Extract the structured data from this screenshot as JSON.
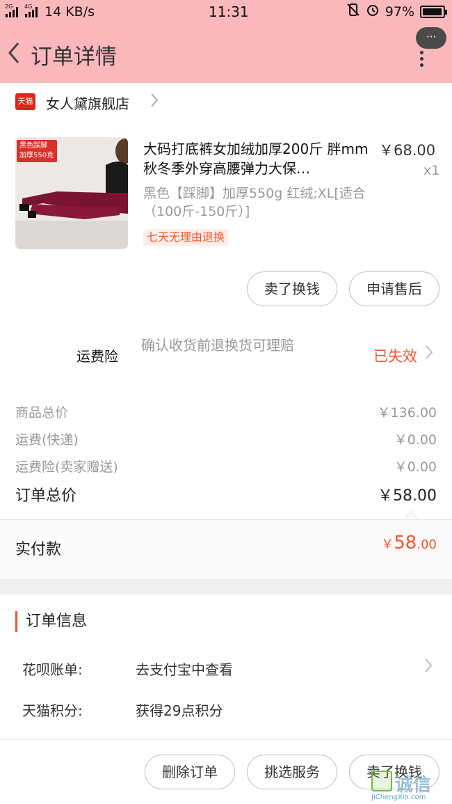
{
  "status_bar": {
    "network_left": "2G",
    "network_right": "4G",
    "speed": "14 KB/s",
    "time": "11:31",
    "battery": "97%",
    "battery_level": 0.97
  },
  "nav": {
    "title": "订单详情",
    "more_bubble": "···"
  },
  "shop": {
    "badge": "天猫",
    "name": "女人黛旗舰店"
  },
  "product": {
    "image_tag_line1": "黑色踩脚",
    "image_tag_line2": "加厚550克",
    "title": "大码打底裤女加绒加厚200斤 胖mm秋冬季外穿高腰弹力大保…",
    "price": "￥68.00",
    "qty": "x1",
    "sku": "黑色【踩脚】加厚550g 红绒;XL[适合（100斤-150斤）]",
    "return_tag": "七天无理由退换"
  },
  "item_actions": {
    "sell_label": "卖了换钱",
    "aftersale_label": "申请售后"
  },
  "insurance": {
    "label": "运费险",
    "desc": "确认收货前退换货可理赔",
    "status": "已失效"
  },
  "fees": {
    "goods_label": "商品总价",
    "goods_value": "￥136.00",
    "shipping_label": "运费(快递)",
    "shipping_value": "￥0.00",
    "insurance_label": "运费险(卖家赠送)",
    "insurance_value": "￥0.00",
    "total_label": "订单总价",
    "total_value": "￥58.00"
  },
  "paid": {
    "label": "实付款",
    "currency": "￥",
    "integer": "58",
    "decimal": ".00"
  },
  "order_info": {
    "title": "订单信息",
    "huabei_label": "花呗账单:",
    "huabei_value": "去支付宝中查看",
    "points_label": "天猫积分:",
    "points_value": "获得29点积分"
  },
  "bottom_actions": {
    "delete_label": "删除订单",
    "service_label": "挑选服务",
    "sell_label": "卖了换钱"
  },
  "watermark": {
    "text": "诚信",
    "url": "JiChengXin.com"
  },
  "colors": {
    "header_bg": "#fbb8bb",
    "accent": "#f0552a",
    "tmall_red": "#e0241d"
  }
}
